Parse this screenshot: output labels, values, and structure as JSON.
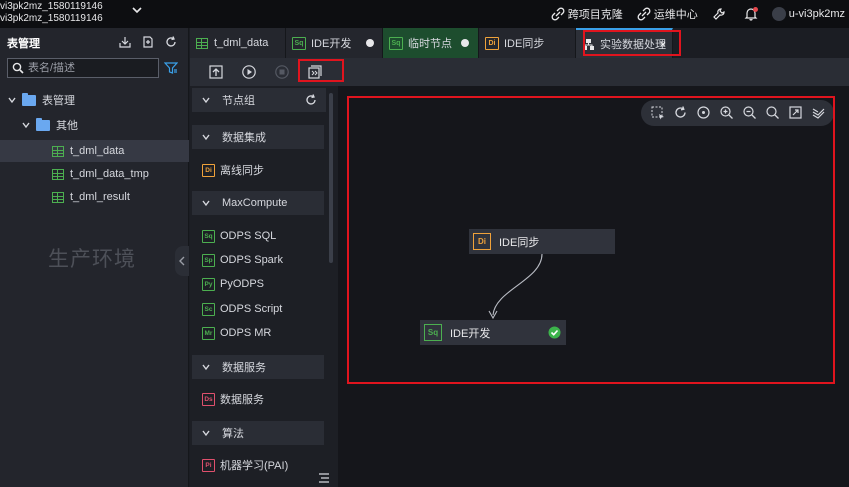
{
  "workspace": {
    "line1": "vi3pk2mz_1580119146",
    "line2": "vi3pk2mz_1580119146"
  },
  "top_nav": {
    "cross_project_clone": "跨项目克隆",
    "ops_center": "运维中心",
    "user": "u-vi3pk2mz"
  },
  "left_panel": {
    "title": "表管理",
    "search_placeholder": "表名/描述",
    "tree": {
      "root": "表管理",
      "folder": "其他",
      "tables": [
        "t_dml_data",
        "t_dml_data_tmp",
        "t_dml_result"
      ]
    },
    "watermark": "生产环境"
  },
  "tabs": [
    {
      "label": "t_dml_data",
      "icon": "table-icon"
    },
    {
      "label": "IDE开发",
      "icon": "Sq"
    },
    {
      "label": "临时节点",
      "icon": "Sq"
    },
    {
      "label": "IDE同步",
      "icon": "Di"
    },
    {
      "label": "实验数据处理",
      "icon": "flow-icon",
      "close": "×"
    }
  ],
  "palette": {
    "groups": [
      {
        "label": "节点组"
      },
      {
        "label": "数据集成",
        "items": [
          {
            "icon": "Di",
            "label": "离线同步"
          }
        ]
      },
      {
        "label": "MaxCompute",
        "items": [
          {
            "icon": "Sq",
            "label": "ODPS SQL"
          },
          {
            "icon": "Sp",
            "label": "ODPS Spark"
          },
          {
            "icon": "Py",
            "label": "PyODPS"
          },
          {
            "icon": "Sc",
            "label": "ODPS Script"
          },
          {
            "icon": "Mr",
            "label": "ODPS MR"
          }
        ]
      },
      {
        "label": "数据服务",
        "items": [
          {
            "icon": "Ds",
            "label": "数据服务"
          }
        ]
      },
      {
        "label": "算法",
        "items": [
          {
            "icon": "Pi",
            "label": "机器学习(PAI)"
          }
        ]
      }
    ]
  },
  "canvas": {
    "nodes": [
      {
        "icon": "Di",
        "label": "IDE同步"
      },
      {
        "icon": "Sq",
        "label": "IDE开发",
        "status": "success"
      }
    ]
  },
  "colors": {
    "highlight_red": "#e0141e",
    "success_green": "#3cb44b",
    "sq_green": "#4caf50",
    "di_orange": "#f0a23a"
  }
}
